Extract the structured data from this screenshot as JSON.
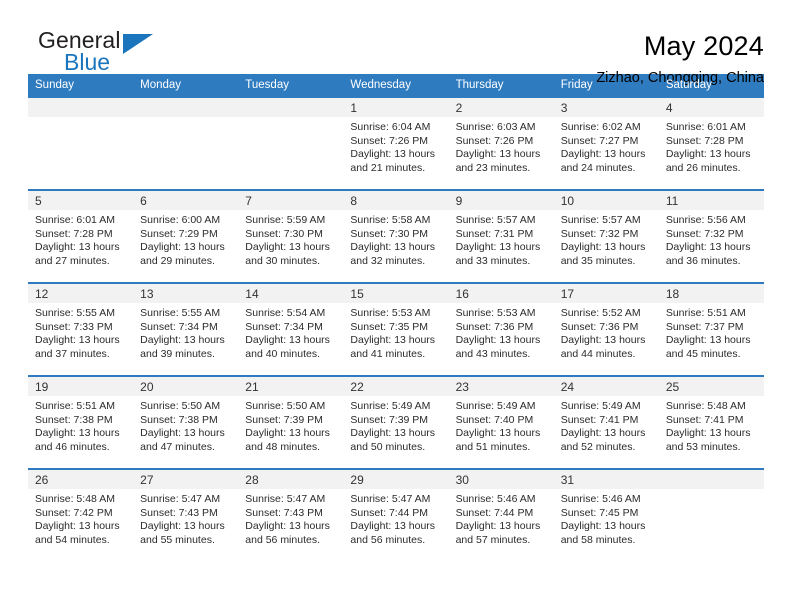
{
  "brand": {
    "name_top": "General",
    "name_bottom": "Blue",
    "flag_icon": "triangle-flag-icon",
    "accent_color": "#1b75bc"
  },
  "header": {
    "title": "May 2024",
    "location": "Zizhao, Chongqing, China"
  },
  "calendar": {
    "header_bg": "#2f7bc0",
    "daynum_bg": "#f2f2f2",
    "weekdays": [
      "Sunday",
      "Monday",
      "Tuesday",
      "Wednesday",
      "Thursday",
      "Friday",
      "Saturday"
    ],
    "weeks": [
      [
        {
          "day": "",
          "empty": true
        },
        {
          "day": "",
          "empty": true
        },
        {
          "day": "",
          "empty": true
        },
        {
          "day": "1",
          "sunrise": "Sunrise: 6:04 AM",
          "sunset": "Sunset: 7:26 PM",
          "daylight_1": "Daylight: 13 hours",
          "daylight_2": "and 21 minutes."
        },
        {
          "day": "2",
          "sunrise": "Sunrise: 6:03 AM",
          "sunset": "Sunset: 7:26 PM",
          "daylight_1": "Daylight: 13 hours",
          "daylight_2": "and 23 minutes."
        },
        {
          "day": "3",
          "sunrise": "Sunrise: 6:02 AM",
          "sunset": "Sunset: 7:27 PM",
          "daylight_1": "Daylight: 13 hours",
          "daylight_2": "and 24 minutes."
        },
        {
          "day": "4",
          "sunrise": "Sunrise: 6:01 AM",
          "sunset": "Sunset: 7:28 PM",
          "daylight_1": "Daylight: 13 hours",
          "daylight_2": "and 26 minutes."
        }
      ],
      [
        {
          "day": "5",
          "sunrise": "Sunrise: 6:01 AM",
          "sunset": "Sunset: 7:28 PM",
          "daylight_1": "Daylight: 13 hours",
          "daylight_2": "and 27 minutes."
        },
        {
          "day": "6",
          "sunrise": "Sunrise: 6:00 AM",
          "sunset": "Sunset: 7:29 PM",
          "daylight_1": "Daylight: 13 hours",
          "daylight_2": "and 29 minutes."
        },
        {
          "day": "7",
          "sunrise": "Sunrise: 5:59 AM",
          "sunset": "Sunset: 7:30 PM",
          "daylight_1": "Daylight: 13 hours",
          "daylight_2": "and 30 minutes."
        },
        {
          "day": "8",
          "sunrise": "Sunrise: 5:58 AM",
          "sunset": "Sunset: 7:30 PM",
          "daylight_1": "Daylight: 13 hours",
          "daylight_2": "and 32 minutes."
        },
        {
          "day": "9",
          "sunrise": "Sunrise: 5:57 AM",
          "sunset": "Sunset: 7:31 PM",
          "daylight_1": "Daylight: 13 hours",
          "daylight_2": "and 33 minutes."
        },
        {
          "day": "10",
          "sunrise": "Sunrise: 5:57 AM",
          "sunset": "Sunset: 7:32 PM",
          "daylight_1": "Daylight: 13 hours",
          "daylight_2": "and 35 minutes."
        },
        {
          "day": "11",
          "sunrise": "Sunrise: 5:56 AM",
          "sunset": "Sunset: 7:32 PM",
          "daylight_1": "Daylight: 13 hours",
          "daylight_2": "and 36 minutes."
        }
      ],
      [
        {
          "day": "12",
          "sunrise": "Sunrise: 5:55 AM",
          "sunset": "Sunset: 7:33 PM",
          "daylight_1": "Daylight: 13 hours",
          "daylight_2": "and 37 minutes."
        },
        {
          "day": "13",
          "sunrise": "Sunrise: 5:55 AM",
          "sunset": "Sunset: 7:34 PM",
          "daylight_1": "Daylight: 13 hours",
          "daylight_2": "and 39 minutes."
        },
        {
          "day": "14",
          "sunrise": "Sunrise: 5:54 AM",
          "sunset": "Sunset: 7:34 PM",
          "daylight_1": "Daylight: 13 hours",
          "daylight_2": "and 40 minutes."
        },
        {
          "day": "15",
          "sunrise": "Sunrise: 5:53 AM",
          "sunset": "Sunset: 7:35 PM",
          "daylight_1": "Daylight: 13 hours",
          "daylight_2": "and 41 minutes."
        },
        {
          "day": "16",
          "sunrise": "Sunrise: 5:53 AM",
          "sunset": "Sunset: 7:36 PM",
          "daylight_1": "Daylight: 13 hours",
          "daylight_2": "and 43 minutes."
        },
        {
          "day": "17",
          "sunrise": "Sunrise: 5:52 AM",
          "sunset": "Sunset: 7:36 PM",
          "daylight_1": "Daylight: 13 hours",
          "daylight_2": "and 44 minutes."
        },
        {
          "day": "18",
          "sunrise": "Sunrise: 5:51 AM",
          "sunset": "Sunset: 7:37 PM",
          "daylight_1": "Daylight: 13 hours",
          "daylight_2": "and 45 minutes."
        }
      ],
      [
        {
          "day": "19",
          "sunrise": "Sunrise: 5:51 AM",
          "sunset": "Sunset: 7:38 PM",
          "daylight_1": "Daylight: 13 hours",
          "daylight_2": "and 46 minutes."
        },
        {
          "day": "20",
          "sunrise": "Sunrise: 5:50 AM",
          "sunset": "Sunset: 7:38 PM",
          "daylight_1": "Daylight: 13 hours",
          "daylight_2": "and 47 minutes."
        },
        {
          "day": "21",
          "sunrise": "Sunrise: 5:50 AM",
          "sunset": "Sunset: 7:39 PM",
          "daylight_1": "Daylight: 13 hours",
          "daylight_2": "and 48 minutes."
        },
        {
          "day": "22",
          "sunrise": "Sunrise: 5:49 AM",
          "sunset": "Sunset: 7:39 PM",
          "daylight_1": "Daylight: 13 hours",
          "daylight_2": "and 50 minutes."
        },
        {
          "day": "23",
          "sunrise": "Sunrise: 5:49 AM",
          "sunset": "Sunset: 7:40 PM",
          "daylight_1": "Daylight: 13 hours",
          "daylight_2": "and 51 minutes."
        },
        {
          "day": "24",
          "sunrise": "Sunrise: 5:49 AM",
          "sunset": "Sunset: 7:41 PM",
          "daylight_1": "Daylight: 13 hours",
          "daylight_2": "and 52 minutes."
        },
        {
          "day": "25",
          "sunrise": "Sunrise: 5:48 AM",
          "sunset": "Sunset: 7:41 PM",
          "daylight_1": "Daylight: 13 hours",
          "daylight_2": "and 53 minutes."
        }
      ],
      [
        {
          "day": "26",
          "sunrise": "Sunrise: 5:48 AM",
          "sunset": "Sunset: 7:42 PM",
          "daylight_1": "Daylight: 13 hours",
          "daylight_2": "and 54 minutes."
        },
        {
          "day": "27",
          "sunrise": "Sunrise: 5:47 AM",
          "sunset": "Sunset: 7:43 PM",
          "daylight_1": "Daylight: 13 hours",
          "daylight_2": "and 55 minutes."
        },
        {
          "day": "28",
          "sunrise": "Sunrise: 5:47 AM",
          "sunset": "Sunset: 7:43 PM",
          "daylight_1": "Daylight: 13 hours",
          "daylight_2": "and 56 minutes."
        },
        {
          "day": "29",
          "sunrise": "Sunrise: 5:47 AM",
          "sunset": "Sunset: 7:44 PM",
          "daylight_1": "Daylight: 13 hours",
          "daylight_2": "and 56 minutes."
        },
        {
          "day": "30",
          "sunrise": "Sunrise: 5:46 AM",
          "sunset": "Sunset: 7:44 PM",
          "daylight_1": "Daylight: 13 hours",
          "daylight_2": "and 57 minutes."
        },
        {
          "day": "31",
          "sunrise": "Sunrise: 5:46 AM",
          "sunset": "Sunset: 7:45 PM",
          "daylight_1": "Daylight: 13 hours",
          "daylight_2": "and 58 minutes."
        },
        {
          "day": "",
          "empty": true
        }
      ]
    ]
  }
}
